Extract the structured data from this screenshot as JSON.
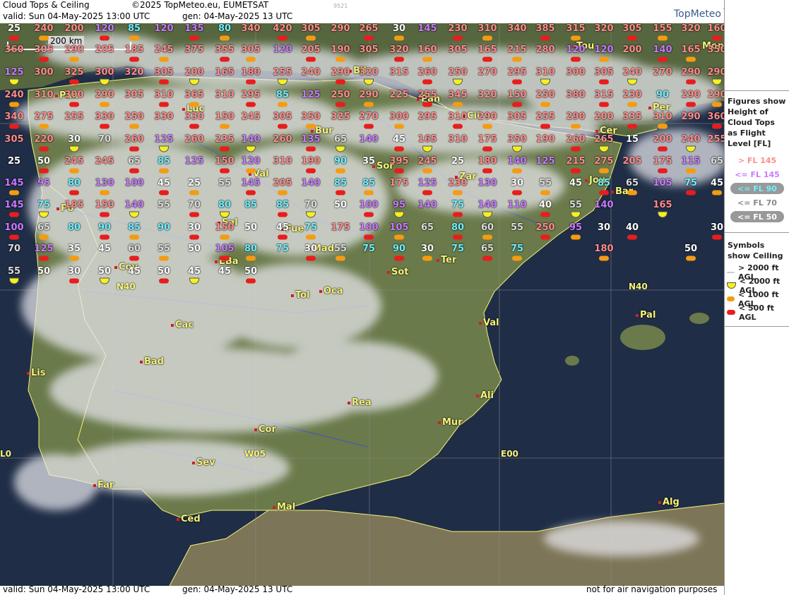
{
  "header": {
    "title": "Cloud Tops & Ceiling",
    "copyright": "©2025 TopMeteo.eu, EUMETSAT",
    "code": "9521",
    "valid_top": "valid:  Sun  04-May-2025  13:00 UTC",
    "gen_top": "gen: 04-May-2025 13 UTC",
    "logo": "TopMeteo"
  },
  "footer": {
    "valid": "valid:  Sun  04-May-2025  13:00 UTC",
    "gen": "gen: 04-May-2025 13 UTC",
    "disclaimer": "not for air navigation purposes"
  },
  "scale": {
    "label": "200 km"
  },
  "legend": {
    "figures_title": "Figures show Height of Cloud Tops as Flight Level  [FL]",
    "fl_items": [
      {
        "label": "> FL 145",
        "color": "#ff8c8c",
        "bg": "none"
      },
      {
        "label": "<= FL 145",
        "color": "#c97bff",
        "bg": "none"
      },
      {
        "label": "<= FL 90",
        "color": "#6ff0ff",
        "bg": "#999999"
      },
      {
        "label": "<= FL 70",
        "color": "#888888",
        "bg": "none"
      },
      {
        "label": "<= FL 50",
        "color": "#ffffff",
        "bg": "#999999"
      }
    ],
    "symbols_title": "Symbols show Ceiling",
    "sym_items": [
      {
        "label": "> 2000 ft AGL",
        "color": "#cccccc"
      },
      {
        "label": "< 2000 ft AGL",
        "color": "#f5f01e"
      },
      {
        "label": "< 1000 ft AGL",
        "color": "#f39c12"
      },
      {
        "label": "< 500 ft AGL",
        "color": "#e81d1d"
      }
    ]
  },
  "coords": [
    "N40",
    "N40",
    "W05",
    "E00",
    "L0"
  ],
  "cities": [
    "Tou",
    "Mon",
    "Bil",
    "Pan",
    "Pan",
    "Luc",
    "Cil",
    "Per",
    "Bur",
    "Cer",
    "Val",
    "Sor",
    "Zar",
    "Jou",
    "Bar",
    "Po",
    "Sal",
    "Fue",
    "Mad",
    "EBa",
    "Cov",
    "Sot",
    "Ter",
    "Tol",
    "Oca",
    "Pal",
    "Val",
    "Cac",
    "Bad",
    "Lis",
    "Ali",
    "Rea",
    "Mur",
    "Cor",
    "Sev",
    "Far",
    "Mal",
    "Ced",
    "Alg"
  ],
  "numbers": [
    "25",
    "240",
    "200",
    "120",
    "85",
    "120",
    "135",
    "80",
    "340",
    "420",
    "305",
    "290",
    "265",
    "30",
    "145",
    "230",
    "310",
    "340",
    "385",
    "315",
    "320",
    "305",
    "155",
    "320",
    "160",
    "360",
    "305",
    "290",
    "205",
    "185",
    "245",
    "375",
    "355",
    "305",
    "120",
    "205",
    "190",
    "305",
    "320",
    "160",
    "305",
    "165",
    "215",
    "280",
    "120",
    "120",
    "200",
    "140",
    "165",
    "350",
    "125",
    "300",
    "325",
    "300",
    "320",
    "305",
    "200",
    "165",
    "180",
    "255",
    "240",
    "290",
    "320",
    "315",
    "260",
    "250",
    "270",
    "295",
    "310",
    "300",
    "305",
    "240",
    "270",
    "290",
    "290",
    "240",
    "310",
    "300",
    "290",
    "305",
    "310",
    "365",
    "310",
    "295",
    "85",
    "125",
    "250",
    "290",
    "225",
    "255",
    "345",
    "320",
    "150",
    "250",
    "380",
    "315",
    "230",
    "90",
    "290",
    "290",
    "340",
    "275",
    "255",
    "330",
    "250",
    "330",
    "330",
    "150",
    "245",
    "305",
    "350",
    "325",
    "270",
    "300",
    "295",
    "310",
    "290",
    "305",
    "255",
    "290",
    "200",
    "335",
    "310",
    "290",
    "360",
    "305",
    "220",
    "30",
    "70",
    "260",
    "125",
    "260",
    "235",
    "140",
    "260",
    "135",
    "65",
    "140",
    "45",
    "165",
    "310",
    "175",
    "350",
    "190",
    "260",
    "265",
    "15",
    "200",
    "240",
    "255",
    "25",
    "50",
    "245",
    "245",
    "65",
    "85",
    "125",
    "150",
    "120",
    "310",
    "190",
    "90",
    "35",
    "395",
    "245",
    "25",
    "180",
    "140",
    "125",
    "215",
    "275",
    "205",
    "175",
    "115",
    "65",
    "145",
    "95",
    "80",
    "130",
    "100",
    "45",
    "25",
    "55",
    "145",
    "205",
    "140",
    "85",
    "85",
    "175",
    "125",
    "230",
    "130",
    "30",
    "55",
    "45",
    "85",
    "65",
    "105",
    "75",
    "45",
    "145",
    "75",
    "185",
    "150",
    "140",
    "55",
    "70",
    "80",
    "85",
    "85",
    "70",
    "50",
    "100",
    "95",
    "140",
    "75",
    "140",
    "110",
    "40",
    "55",
    "140",
    "165",
    "100",
    "65",
    "80",
    "90",
    "85",
    "90",
    "30",
    "150",
    "50",
    "45",
    "75",
    "175",
    "100",
    "105",
    "65",
    "80",
    "60",
    "55",
    "250",
    "95",
    "30",
    "40",
    "30",
    "70",
    "125",
    "35",
    "45",
    "60",
    "55",
    "50",
    "105",
    "80",
    "75",
    "30",
    "55",
    "75",
    "90",
    "30",
    "75",
    "65",
    "75",
    "180",
    "50",
    "55",
    "50",
    "30",
    "50",
    "45",
    "50",
    "45",
    "45",
    "50"
  ]
}
